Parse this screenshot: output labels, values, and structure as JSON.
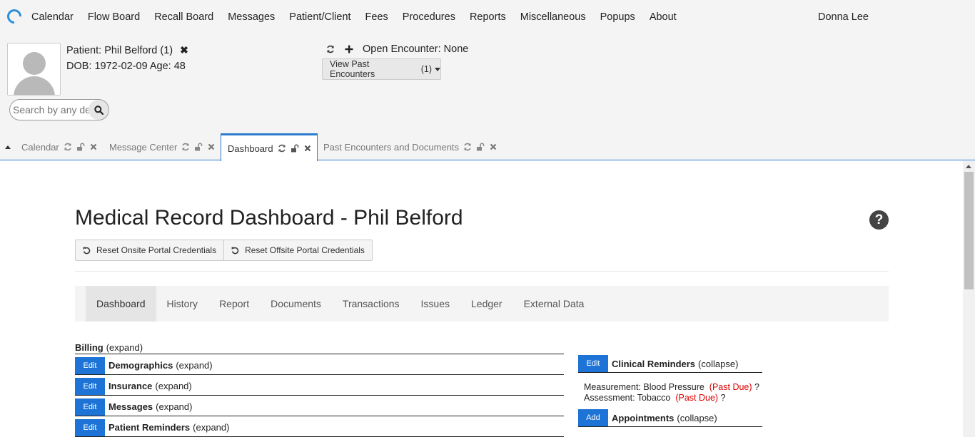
{
  "nav": {
    "items": [
      "Calendar",
      "Flow Board",
      "Recall Board",
      "Messages",
      "Patient/Client",
      "Fees",
      "Procedures",
      "Reports",
      "Miscellaneous",
      "Popups",
      "About"
    ],
    "user": "Donna Lee"
  },
  "patient": {
    "label": "Patient: Phil Belford (1)",
    "dob": "DOB: 1972-02-09 Age: 48",
    "search_placeholder": "Search by any demographics",
    "open_encounter": "Open Encounter: None",
    "past_encounters_label": "View Past Encounters",
    "past_encounters_count": "(1)"
  },
  "tabs": [
    {
      "label": "Calendar"
    },
    {
      "label": "Message Center"
    },
    {
      "label": "Dashboard"
    },
    {
      "label": "Past Encounters and Documents"
    }
  ],
  "dashboard": {
    "title": "Medical Record Dashboard - Phil Belford",
    "help": "?",
    "reset_onsite": "Reset Onsite Portal Credentials",
    "reset_offsite": "Reset Offsite Portal Credentials",
    "subnav": [
      "Dashboard",
      "History",
      "Report",
      "Documents",
      "Transactions",
      "Issues",
      "Ledger",
      "External Data"
    ],
    "billing": {
      "title": "Billing",
      "toggle": "(expand)"
    },
    "sections": [
      {
        "button": "Edit",
        "title": "Demographics",
        "toggle": "(expand)"
      },
      {
        "button": "Edit",
        "title": "Insurance",
        "toggle": "(expand)"
      },
      {
        "button": "Edit",
        "title": "Messages",
        "toggle": "(expand)"
      },
      {
        "button": "Edit",
        "title": "Patient Reminders",
        "toggle": "(expand)"
      }
    ],
    "clinical_reminders": {
      "button": "Edit",
      "title": "Clinical Reminders",
      "toggle": "(collapse)"
    },
    "reminders": [
      {
        "text": "Measurement: Blood Pressure",
        "status": "(Past Due)",
        "help": "?"
      },
      {
        "text": "Assessment: Tobacco",
        "status": "(Past Due)",
        "help": "?"
      }
    ],
    "appointments": {
      "button": "Add",
      "title": "Appointments",
      "toggle": "(collapse)"
    }
  },
  "colors": {
    "accent": "#1d73d6",
    "past_due": "#dd0000",
    "tab_border": "#2e7cd0"
  }
}
